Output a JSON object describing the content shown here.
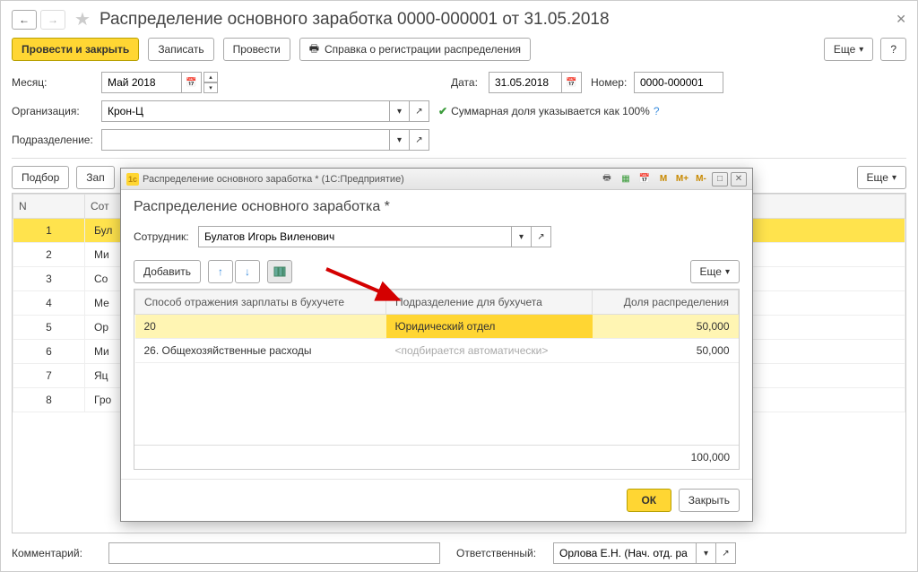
{
  "header": {
    "title": "Распределение основного заработка 0000-000001 от 31.05.2018"
  },
  "toolbar": {
    "post_close": "Провести и закрыть",
    "save": "Записать",
    "post": "Провести",
    "cert": "Справка о регистрации распределения",
    "more": "Еще",
    "help": "?"
  },
  "form": {
    "month_label": "Месяц:",
    "month_value": "Май 2018",
    "date_label": "Дата:",
    "date_value": "31.05.2018",
    "number_label": "Номер:",
    "number_value": "0000-000001",
    "org_label": "Организация:",
    "org_value": "Крон-Ц",
    "sum_checkbox": "Суммарная доля указывается как 100%",
    "dept_label": "Подразделение:"
  },
  "table_toolbar": {
    "pick": "Подбор",
    "fill": "Зап",
    "more": "Еще"
  },
  "main_table": {
    "columns": {
      "n": "N",
      "emp": "Сот"
    },
    "rows": [
      {
        "n": "1",
        "emp": "Бул"
      },
      {
        "n": "2",
        "emp": "Ми"
      },
      {
        "n": "3",
        "emp": "Со"
      },
      {
        "n": "4",
        "emp": "Ме"
      },
      {
        "n": "5",
        "emp": "Ор"
      },
      {
        "n": "6",
        "emp": "Ми"
      },
      {
        "n": "7",
        "emp": "Яц"
      },
      {
        "n": "8",
        "emp": "Гро"
      }
    ]
  },
  "bottom": {
    "comment_label": "Комментарий:",
    "resp_label": "Ответственный:",
    "resp_value": "Орлова Е.Н. (Нач. отд. ра"
  },
  "modal": {
    "window_title": "Распределение основного заработка * (1С:Предприятие)",
    "heading": "Распределение основного заработка *",
    "employee_label": "Сотрудник:",
    "employee_value": "Булатов Игорь Виленович",
    "add_btn": "Добавить",
    "more": "Еще",
    "columns": {
      "method": "Способ отражения зарплаты в бухучете",
      "dept": "Подразделение для бухучета",
      "share": "Доля распределения"
    },
    "rows": [
      {
        "method": "20",
        "dept": "Юридический отдел",
        "share": "50,000",
        "selected": true
      },
      {
        "method": "26. Общехозяйственные расходы",
        "dept_placeholder": "<подбирается автоматически>",
        "share": "50,000"
      }
    ],
    "total": "100,000",
    "ok": "ОК",
    "close": "Закрыть",
    "memory": {
      "m": "M",
      "mplus": "M+",
      "mminus": "M-"
    }
  }
}
